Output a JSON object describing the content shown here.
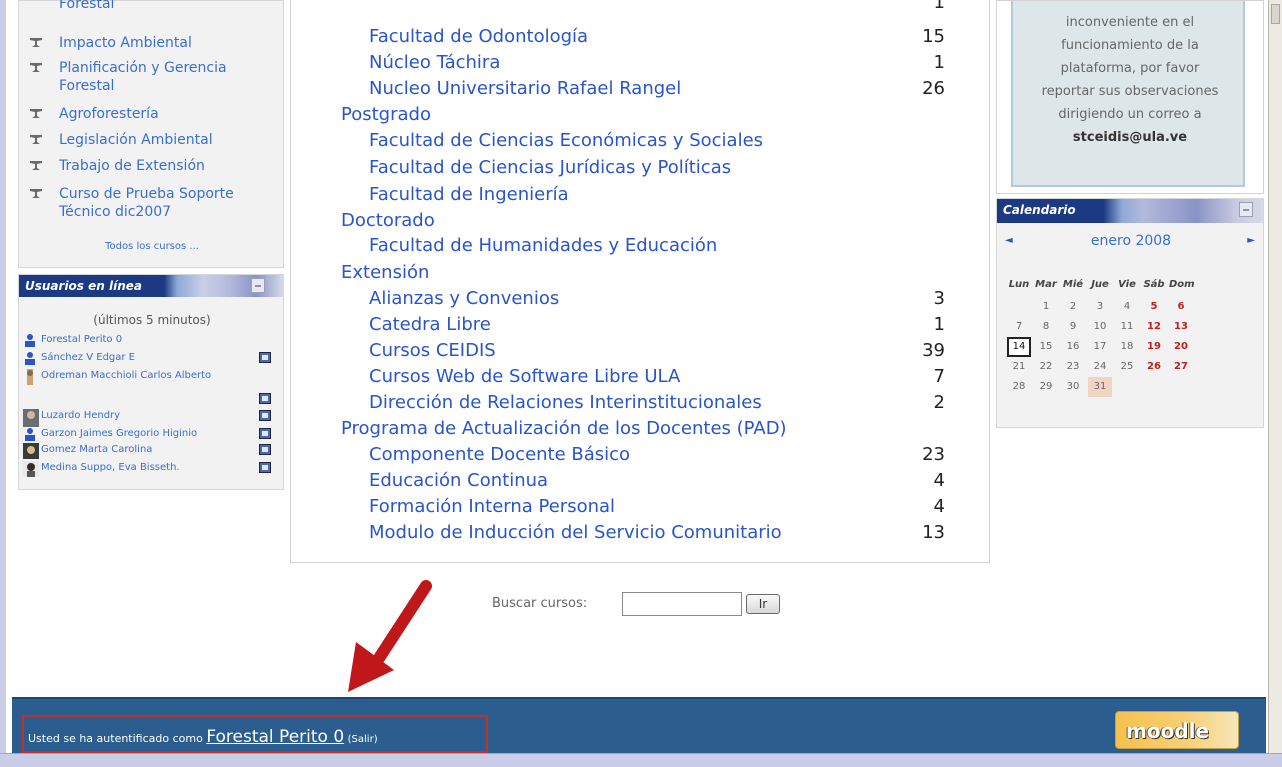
{
  "courses_block": {
    "items": [
      {
        "label": "Forestal"
      },
      {
        "label": "Impacto Ambiental"
      },
      {
        "label": "Planificación y Gerencia Forestal"
      },
      {
        "label": "Agroforestería"
      },
      {
        "label": "Legislación Ambiental"
      },
      {
        "label": "Trabajo de Extensión"
      },
      {
        "label": "Curso de Prueba Soporte Técnico dic2007"
      }
    ],
    "all_courses": "Todos los cursos ..."
  },
  "users_block": {
    "title": "Usuarios en línea",
    "period": "(últimos 5 minutos)",
    "users": [
      {
        "name": "Forestal Perito 0",
        "icon": "user-icon"
      },
      {
        "name": "Sánchez V Edgar E",
        "icon": "user-icon"
      },
      {
        "name": "Odreman Macchioli Carlos Alberto",
        "icon": "avatar-icon"
      },
      {
        "name": "Luzardo Hendry",
        "icon": "avatar-icon"
      },
      {
        "name": "Garzon Jaimes Gregorio Higinio",
        "icon": "user-icon"
      },
      {
        "name": "Gomez Marta Carolina",
        "icon": "avatar-icon"
      },
      {
        "name": "Medina Suppo, Eva Bisseth.",
        "icon": "avatar-icon"
      }
    ]
  },
  "categories": [
    {
      "label": "Facultad de Odontología",
      "count": "15",
      "level": "sub"
    },
    {
      "label": "Núcleo Táchira",
      "count": "1",
      "level": "sub"
    },
    {
      "label": "Nucleo Universitario Rafael Rangel",
      "count": "26",
      "level": "sub"
    },
    {
      "label": "Postgrado",
      "count": "",
      "level": "top"
    },
    {
      "label": "Facultad de Ciencias Económicas y Sociales",
      "count": "",
      "level": "sub"
    },
    {
      "label": "Facultad de Ciencias Jurídicas y Políticas",
      "count": "",
      "level": "sub"
    },
    {
      "label": "Facultad de Ingeniería",
      "count": "",
      "level": "sub"
    },
    {
      "label": "Doctorado",
      "count": "",
      "level": "top"
    },
    {
      "label": "Facultad de Humanidades y Educación",
      "count": "",
      "level": "sub"
    },
    {
      "label": "Extensión",
      "count": "",
      "level": "top"
    },
    {
      "label": "Alianzas y Convenios",
      "count": "3",
      "level": "sub"
    },
    {
      "label": "Catedra Libre",
      "count": "1",
      "level": "sub"
    },
    {
      "label": "Cursos CEIDIS",
      "count": "39",
      "level": "sub"
    },
    {
      "label": "Cursos Web de Software Libre ULA",
      "count": "7",
      "level": "sub"
    },
    {
      "label": "Dirección de Relaciones Interinstitucionales",
      "count": "2",
      "level": "sub"
    },
    {
      "label": "Programa de Actualización de los Docentes (PAD)",
      "count": "",
      "level": "top"
    },
    {
      "label": "Componente Docente Básico",
      "count": "23",
      "level": "sub"
    },
    {
      "label": "Educación Continua",
      "count": "4",
      "level": "sub"
    },
    {
      "label": "Formación Interna Personal",
      "count": "4",
      "level": "sub"
    },
    {
      "label": "Modulo de Inducción del Servicio Comunitario",
      "count": "13",
      "level": "sub"
    }
  ],
  "search": {
    "label": "Buscar cursos:",
    "value": "",
    "button": "Ir"
  },
  "notice": {
    "lines": [
      "inconveniente en el",
      "funcionamiento de la",
      "plataforma, por favor",
      "reportar sus observaciones",
      "dirigiendo un correo a"
    ],
    "email": "stceidis@ula.ve"
  },
  "calendar": {
    "title": "Calendario",
    "month": "enero 2008",
    "prev": "◄",
    "next": "►",
    "weekdays": [
      "Lun",
      "Mar",
      "Mié",
      "Jue",
      "Vie",
      "Sáb",
      "Dom"
    ],
    "first_weekday_offset": 1,
    "days_in_month": 31,
    "today": 14,
    "event_days": [
      31
    ]
  },
  "footer": {
    "login_prefix": "Usted se ha autentificado como ",
    "user": "Forestal Perito 0",
    "logout": "(Salir)",
    "logo": "moodle"
  },
  "colors": {
    "link": "#2a55c8",
    "footer": "#2b5e8f",
    "highlight_box": "#c23030",
    "arrow": "#c0181a"
  }
}
